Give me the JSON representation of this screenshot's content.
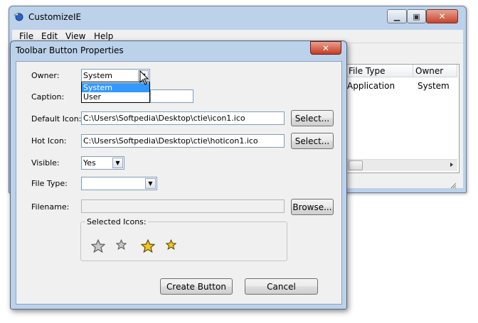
{
  "main_window": {
    "title": "CustomizeIE",
    "controls": {
      "minimize": "▁",
      "restore": "▣",
      "close": "✕"
    },
    "menu": [
      "File",
      "Edit",
      "View",
      "Help"
    ],
    "list": {
      "columns": [
        "File Type",
        "Owner"
      ],
      "rows": [
        {
          "file_type": "Application",
          "owner": "System"
        }
      ]
    }
  },
  "dialog": {
    "title": "Toolbar Button Properties",
    "close": "✕",
    "owner": {
      "label": "Owner:",
      "value": "System",
      "options": [
        "System",
        "User"
      ],
      "selected_index": 0
    },
    "caption": {
      "label": "Caption:",
      "value": ""
    },
    "default_icon": {
      "label": "Default Icon:",
      "value": "C:\\Users\\Softpedia\\Desktop\\ctie\\icon1.ico",
      "button": "Select..."
    },
    "hot_icon": {
      "label": "Hot Icon:",
      "value": "C:\\Users\\Softpedia\\Desktop\\ctie\\hoticon1.ico",
      "button": "Select..."
    },
    "visible": {
      "label": "Visible:",
      "value": "Yes"
    },
    "file_type": {
      "label": "File Type:",
      "value": ""
    },
    "filename": {
      "label": "Filename:",
      "value": "",
      "button": "Browse..."
    },
    "selected_icons": {
      "label": "Selected Icons:",
      "icons": [
        "gray-star-large",
        "gray-star-small",
        "gold-star-large",
        "gold-star-small"
      ]
    },
    "buttons": {
      "create": "Create Button",
      "cancel": "Cancel"
    }
  },
  "colors": {
    "frame": "#bcd1ea",
    "selection": "#3399ff",
    "star_gold": "#f5c518",
    "star_gray": "#c8c8c8"
  }
}
